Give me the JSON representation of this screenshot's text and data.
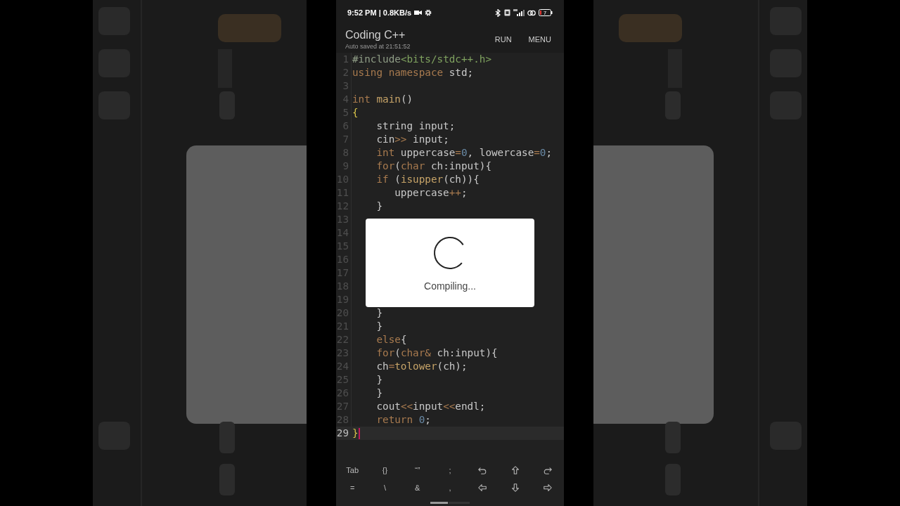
{
  "status_bar": {
    "time": "9:52 PM | 0.8KB/s",
    "battery": "7"
  },
  "app_bar": {
    "title": "Coding C++",
    "subtitle": "Auto saved at 21:51:52",
    "actions": [
      "RUN",
      "MENU"
    ]
  },
  "editor": {
    "lines": [
      {
        "number": "1",
        "current": false,
        "tokens": [
          {
            "kind": "directive",
            "text": "#include"
          },
          {
            "kind": "string",
            "text": "<bits/stdc++.h>"
          }
        ]
      },
      {
        "number": "2",
        "current": false,
        "tokens": [
          {
            "kind": "keyword",
            "text": "using namespace"
          },
          {
            "kind": "plain",
            "text": " std;"
          }
        ]
      },
      {
        "number": "3",
        "current": false
      },
      {
        "number": "4",
        "current": false,
        "tokens": [
          {
            "kind": "keyword",
            "text": "int"
          },
          {
            "kind": "function",
            "text": " main"
          },
          {
            "kind": "plain",
            "text": "()"
          }
        ]
      },
      {
        "number": "5",
        "current": false,
        "tokens": [
          {
            "kind": "bracket",
            "text": "{"
          }
        ]
      },
      {
        "number": "6",
        "current": false,
        "tokens": [
          {
            "kind": "plain",
            "text": "    string input;"
          }
        ]
      },
      {
        "number": "7",
        "current": false,
        "tokens": [
          {
            "kind": "plain",
            "text": "    cin"
          },
          {
            "kind": "operator",
            "text": ">>"
          },
          {
            "kind": "plain",
            "text": " input;"
          }
        ]
      },
      {
        "number": "8",
        "current": false,
        "tokens": [
          {
            "kind": "keyword",
            "text": "    int"
          },
          {
            "kind": "plain",
            "text": " uppercase"
          },
          {
            "kind": "operator",
            "text": "="
          },
          {
            "kind": "number",
            "text": "0"
          },
          {
            "kind": "plain",
            "text": ", lowercase"
          },
          {
            "kind": "operator",
            "text": "="
          },
          {
            "kind": "number",
            "text": "0"
          },
          {
            "kind": "plain",
            "text": ";"
          }
        ]
      },
      {
        "number": "9",
        "current": false,
        "tokens": [
          {
            "kind": "keyword",
            "text": "    for"
          },
          {
            "kind": "plain",
            "text": "("
          },
          {
            "kind": "keyword",
            "text": "char"
          },
          {
            "kind": "plain",
            "text": " ch:input){"
          }
        ]
      },
      {
        "number": "10",
        "current": false,
        "tokens": [
          {
            "kind": "keyword",
            "text": "    if"
          },
          {
            "kind": "plain",
            "text": " ("
          },
          {
            "kind": "function",
            "text": "isupper"
          },
          {
            "kind": "plain",
            "text": "(ch)){"
          }
        ]
      },
      {
        "number": "11",
        "current": false,
        "tokens": [
          {
            "kind": "plain",
            "text": "       uppercase"
          },
          {
            "kind": "operator",
            "text": "++"
          },
          {
            "kind": "plain",
            "text": ";"
          }
        ]
      },
      {
        "number": "12",
        "current": false,
        "tokens": [
          {
            "kind": "plain",
            "text": "    }"
          }
        ]
      },
      {
        "number": "13",
        "current": false
      },
      {
        "number": "14",
        "current": false
      },
      {
        "number": "15",
        "current": false
      },
      {
        "number": "16",
        "current": false
      },
      {
        "number": "17",
        "current": false
      },
      {
        "number": "18",
        "current": false
      },
      {
        "number": "19",
        "current": false
      },
      {
        "number": "20",
        "current": false,
        "tokens": [
          {
            "kind": "plain",
            "text": "    }"
          }
        ]
      },
      {
        "number": "21",
        "current": false,
        "tokens": [
          {
            "kind": "plain",
            "text": "    }"
          }
        ]
      },
      {
        "number": "22",
        "current": false,
        "tokens": [
          {
            "kind": "keyword",
            "text": "    else"
          },
          {
            "kind": "plain",
            "text": "{"
          }
        ]
      },
      {
        "number": "23",
        "current": false,
        "tokens": [
          {
            "kind": "keyword",
            "text": "    for"
          },
          {
            "kind": "plain",
            "text": "("
          },
          {
            "kind": "keyword",
            "text": "char&"
          },
          {
            "kind": "plain",
            "text": " ch:input){"
          }
        ]
      },
      {
        "number": "24",
        "current": false,
        "tokens": [
          {
            "kind": "plain",
            "text": "    ch"
          },
          {
            "kind": "operator",
            "text": "="
          },
          {
            "kind": "function",
            "text": "tolower"
          },
          {
            "kind": "plain",
            "text": "(ch);"
          }
        ]
      },
      {
        "number": "25",
        "current": false,
        "tokens": [
          {
            "kind": "plain",
            "text": "    }"
          }
        ]
      },
      {
        "number": "26",
        "current": false,
        "tokens": [
          {
            "kind": "plain",
            "text": "    }"
          }
        ]
      },
      {
        "number": "27",
        "current": false,
        "tokens": [
          {
            "kind": "plain",
            "text": "    cout"
          },
          {
            "kind": "operator",
            "text": "<<"
          },
          {
            "kind": "plain",
            "text": "input"
          },
          {
            "kind": "operator",
            "text": "<<"
          },
          {
            "kind": "plain",
            "text": "endl;"
          }
        ]
      },
      {
        "number": "28",
        "current": false,
        "tokens": [
          {
            "kind": "keyword",
            "text": "    return"
          },
          {
            "kind": "number",
            "text": " 0"
          },
          {
            "kind": "plain",
            "text": ";"
          }
        ]
      },
      {
        "number": "29",
        "current": true,
        "tokens": [
          {
            "kind": "bracket",
            "text": "}"
          }
        ]
      }
    ]
  },
  "dialog": {
    "message": "Compiling..."
  },
  "keys": [
    [
      {
        "kind": "text",
        "label": "Tab"
      },
      {
        "kind": "text",
        "label": "{}"
      },
      {
        "kind": "text",
        "label": "“”"
      },
      {
        "kind": "text",
        "label": ";"
      },
      {
        "kind": "undo"
      },
      {
        "kind": "arrow-up"
      },
      {
        "kind": "redo"
      }
    ],
    [
      {
        "kind": "text",
        "label": "="
      },
      {
        "kind": "text",
        "label": "\\"
      },
      {
        "kind": "text",
        "label": "&"
      },
      {
        "kind": "text",
        "label": ","
      },
      {
        "kind": "arrow-left"
      },
      {
        "kind": "arrow-down"
      },
      {
        "kind": "arrow-right"
      }
    ]
  ]
}
